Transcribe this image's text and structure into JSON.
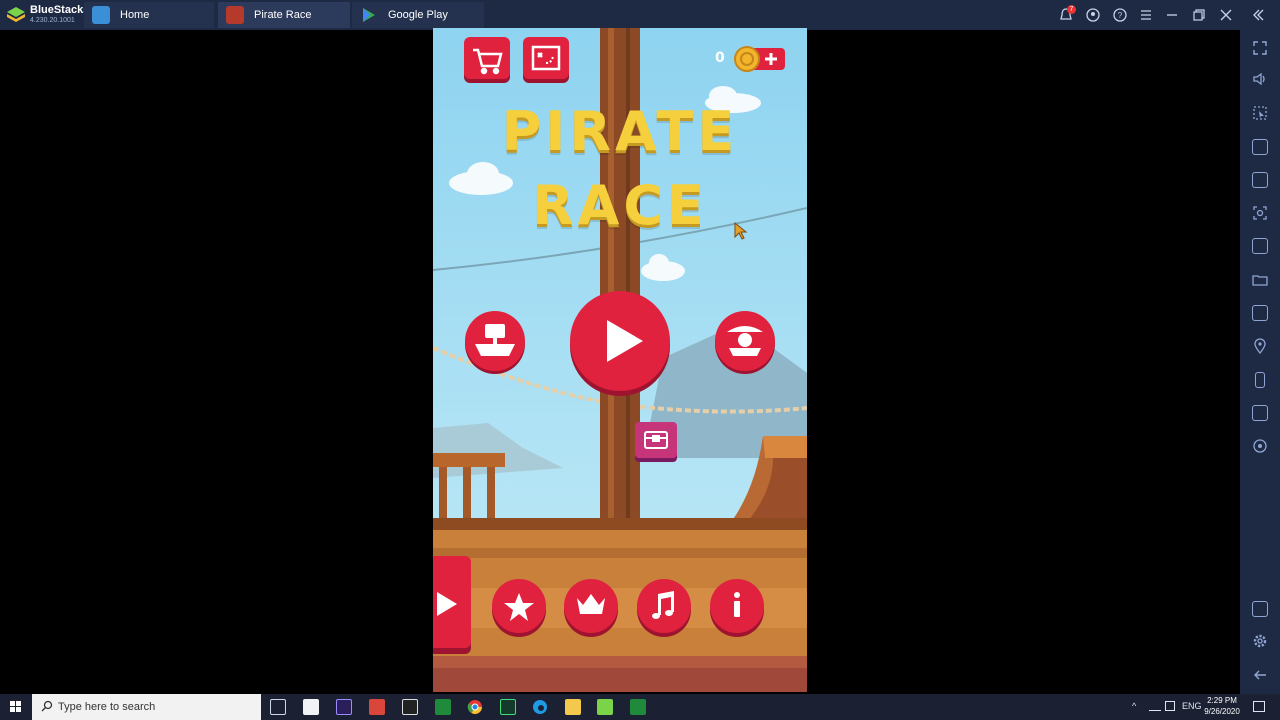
{
  "brand": {
    "name": "BlueStacks",
    "version": "4.230.20.1001"
  },
  "tabs": [
    {
      "label": "Home",
      "icon": "home-icon"
    },
    {
      "label": "Pirate Race",
      "icon": "game-icon"
    },
    {
      "label": "Google Play",
      "icon": "play-store-icon"
    }
  ],
  "notifications": {
    "count": "7"
  },
  "game": {
    "title_line1": "PIRATE",
    "title_line2": "RACE",
    "coins": "0",
    "top_buttons": [
      "shop-cart-icon",
      "map-icon"
    ],
    "main_buttons": [
      "ship-icon",
      "play-icon",
      "pirate-ship-icon"
    ],
    "bottom_buttons": [
      "video-play-icon",
      "star-icon",
      "crown-icon",
      "music-icon",
      "info-icon"
    ],
    "chest": "treasure-chest-icon"
  },
  "sidebar_icons": [
    "fullscreen-icon",
    "volume-icon",
    "selection-icon",
    "keyboard-icon",
    "screen-record-icon",
    "screenshot-icon",
    "video-icon",
    "folder-icon",
    "multi-instance-icon",
    "location-icon",
    "rotate-icon",
    "macro-icon",
    "gamepad-icon",
    "help-icon",
    "settings-icon",
    "back-icon"
  ],
  "taskbar": {
    "search_placeholder": "Type here to search",
    "tray_lang": "ENG",
    "time": "2:29 PM",
    "date": "9/26/2020"
  },
  "colors": {
    "button_red": "#e0223f",
    "sky": "#9fd9f2",
    "deck": "#c9803a",
    "title": "#f5cf3c"
  }
}
